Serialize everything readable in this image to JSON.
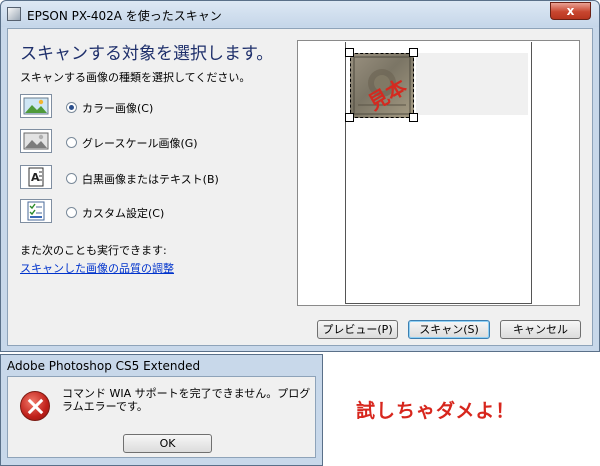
{
  "window": {
    "title": "EPSON PX-402A を使ったスキャン",
    "close_label": "x"
  },
  "main": {
    "heading": "スキャンする対象を選択します。",
    "subheading": "スキャンする画像の種類を選択してください。",
    "options": [
      {
        "label": "カラー画像(C)",
        "selected": true,
        "icon": "color-photo-icon"
      },
      {
        "label": "グレースケール画像(G)",
        "selected": false,
        "icon": "grayscale-photo-icon"
      },
      {
        "label": "白黒画像またはテキスト(B)",
        "selected": false,
        "icon": "text-document-icon"
      },
      {
        "label": "カスタム設定(C)",
        "selected": false,
        "icon": "custom-settings-icon"
      }
    ],
    "also_text": "また次のことも実行できます:",
    "adjust_link": "スキャンした画像の品質の調整"
  },
  "preview": {
    "stamp_text": "見本"
  },
  "buttons": {
    "preview": "プレビュー(P)",
    "scan": "スキャン(S)",
    "cancel": "キャンセル"
  },
  "error_dialog": {
    "title": "Adobe Photoshop CS5 Extended",
    "message": "コマンド WIA サポートを完了できません。プログラムエラーです。",
    "ok": "OK"
  },
  "annotation": {
    "text": "試しちゃダメよ！",
    "color": "#d7261d"
  }
}
